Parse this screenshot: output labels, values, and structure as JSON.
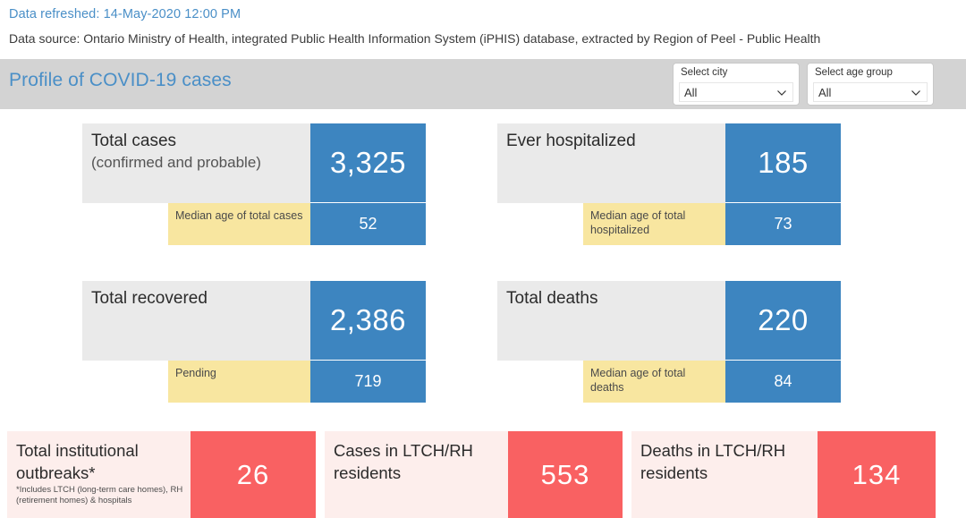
{
  "header": {
    "refreshed_label": "Data refreshed:",
    "refreshed_value": "14-May-2020 12:00 PM",
    "source": "Data source: Ontario Ministry of Health, integrated Public Health Information System (iPHIS) database, extracted by Region of Peel - Public Health"
  },
  "titlebar": {
    "title": "Profile of COVID-19 cases",
    "background": "#d3d3d3",
    "title_color": "#4a8fc7"
  },
  "slicers": [
    {
      "name": "city",
      "label": "Select city",
      "selected": "All",
      "icon": "chevron-down-icon"
    },
    {
      "name": "age-group",
      "label": "Select age group",
      "selected": "All",
      "icon": "chevron-down-icon"
    }
  ],
  "kpi_cards": [
    {
      "id": "total-cases",
      "label_line1": "Total cases",
      "label_line2": "(confirmed and probable)",
      "value": "3,325",
      "sub_label": "Median age of total cases",
      "sub_value": "52"
    },
    {
      "id": "ever-hospitalized",
      "label_line1": "Ever hospitalized",
      "label_line2": "",
      "value": "185",
      "sub_label": "Median age of total hospitalized",
      "sub_value": "73"
    },
    {
      "id": "total-recovered",
      "label_line1": "Total recovered",
      "label_line2": "",
      "value": "2,386",
      "sub_label": "Pending",
      "sub_value": "719"
    },
    {
      "id": "total-deaths",
      "label_line1": "Total deaths",
      "label_line2": "",
      "value": "220",
      "sub_label": "Median age of total deaths",
      "sub_value": "84"
    }
  ],
  "outbreak_cards": [
    {
      "id": "total-institutional-outbreaks",
      "label": "Total institutional outbreaks*",
      "note": "*Includes LTCH (long-term care homes), RH (retirement homes) & hospitals",
      "value": "26"
    },
    {
      "id": "cases-in-ltch-rh-residents",
      "label": "Cases in LTCH/RH residents",
      "note": "",
      "value": "553"
    },
    {
      "id": "deaths-in-ltch-rh-residents",
      "label": "Deaths in LTCH/RH residents",
      "note": "",
      "value": "134"
    }
  ],
  "colors": {
    "blue": "#3d85c0",
    "yellow": "#f8e6a0",
    "gray": "#eaeaea",
    "red": "#f96162",
    "pink": "#fdeeec",
    "accent_text": "#4a8fc7"
  }
}
